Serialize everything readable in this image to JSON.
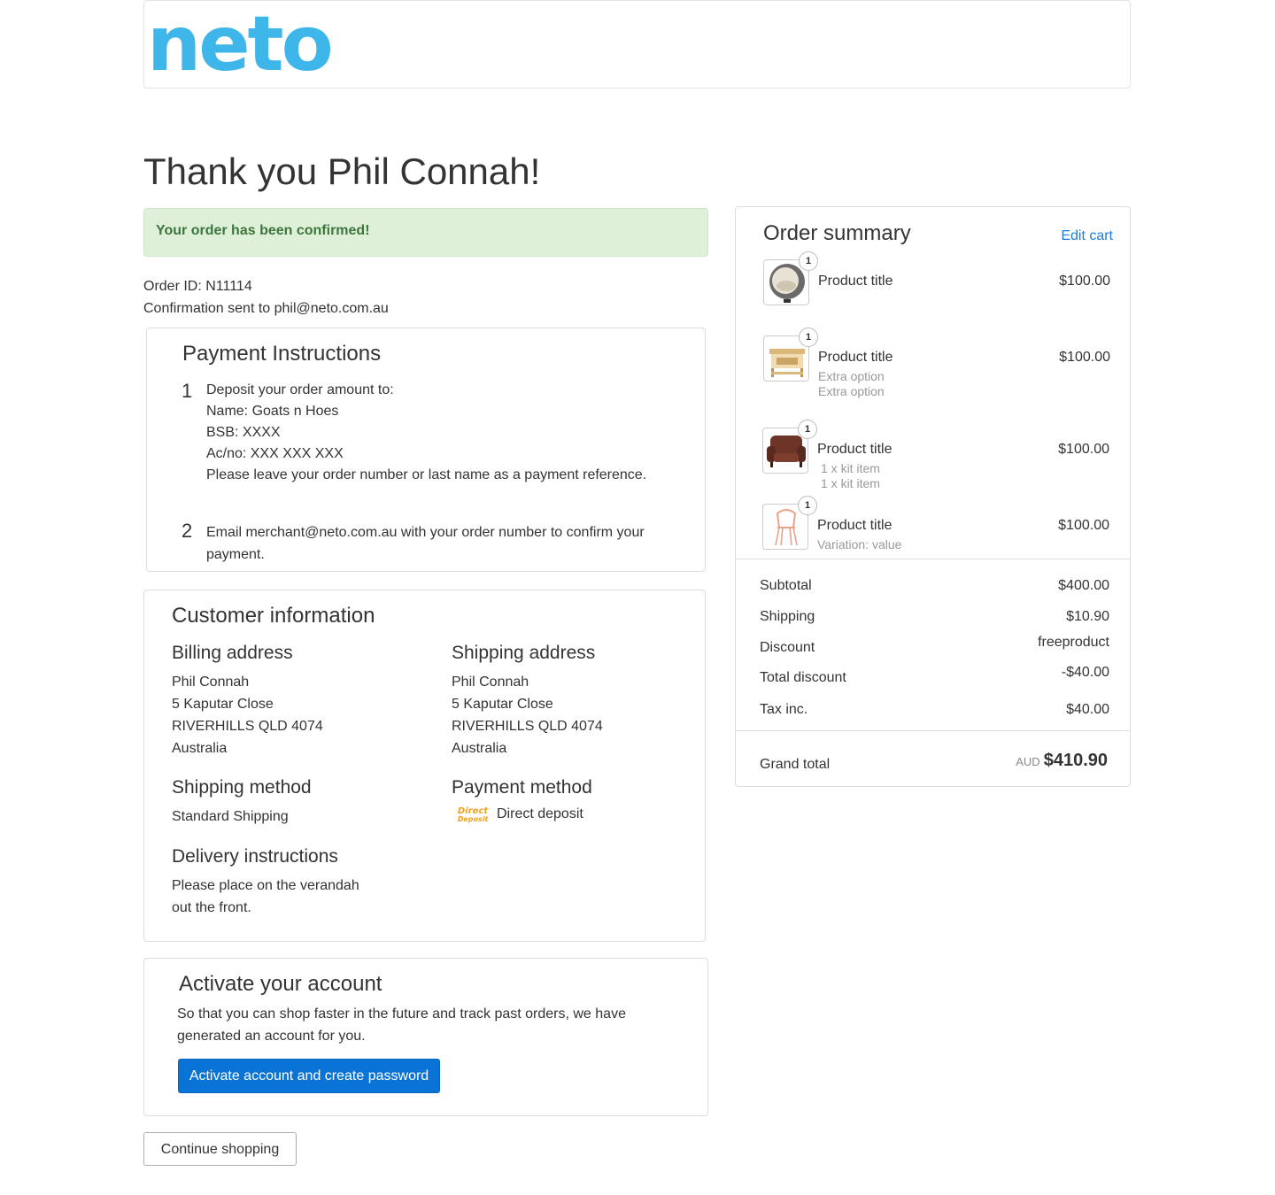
{
  "header": {
    "logo_text": "neto",
    "logo_color": "#3fb6ea"
  },
  "page_title": "Thank you Phil Connah!",
  "alert": {
    "text": "Your order has been confirmed!",
    "color": "#3c763d",
    "background": "#dff0d8"
  },
  "order": {
    "id_line": "Order ID: N11114",
    "confirmation_line": "Confirmation sent to phil@neto.com.au"
  },
  "payment_instructions": {
    "title": "Payment Instructions",
    "steps": [
      {
        "number": "1",
        "lines": [
          "Deposit your order amount to:",
          "Name: Goats n Hoes",
          "BSB: XXXX",
          "Ac/no: XXX XXX XXX",
          "Please leave your order number or last name as a payment reference."
        ]
      },
      {
        "number": "2",
        "lines": [
          "Email merchant@neto.com.au with your order number to confirm your",
          "payment."
        ]
      }
    ]
  },
  "customer": {
    "title": "Customer information",
    "billing": {
      "heading": "Billing address",
      "lines": [
        "Phil Connah",
        "5 Kaputar Close",
        "RIVERHILLS QLD 4074",
        "Australia"
      ]
    },
    "shipping_address": {
      "heading": "Shipping address",
      "lines": [
        "Phil Connah",
        "5 Kaputar Close",
        "RIVERHILLS QLD 4074",
        "Australia"
      ]
    },
    "shipping_method": {
      "heading": "Shipping method",
      "value": "Standard Shipping"
    },
    "payment_method": {
      "heading": "Payment method",
      "value": "Direct deposit",
      "logo_line1": "Direct",
      "logo_line2": "Deposit",
      "logo_color": "#f3a21b"
    },
    "delivery": {
      "heading": "Delivery instructions",
      "lines": [
        "Please place on the verandah",
        "out the front."
      ]
    }
  },
  "activate": {
    "title": "Activate your account",
    "lines": [
      "So that you can shop faster in the future and track past orders, we have",
      "generated an account for you."
    ],
    "button_label": "Activate account and create password",
    "button_color": "#0a74d6"
  },
  "continue_label": "Continue shopping",
  "summary": {
    "title": "Order summary",
    "edit_label": "Edit cart",
    "items": [
      {
        "qty": "1",
        "title": "Product title",
        "price": "$100.00",
        "details": [],
        "thumb": "ball-chair-icon"
      },
      {
        "qty": "1",
        "title": "Product title",
        "price": "$100.00",
        "details": [
          "Extra option",
          "Extra option"
        ],
        "thumb": "side-table-icon"
      },
      {
        "qty": "1",
        "title": "Product title",
        "price": "$100.00",
        "details": [
          "1 x kit item",
          "1 x kit item"
        ],
        "thumb": "leather-sofa-icon"
      },
      {
        "qty": "1",
        "title": "Product title",
        "price": "$100.00",
        "details": [
          "Variation: value"
        ],
        "thumb": "wire-chair-icon"
      }
    ],
    "totals": [
      {
        "label": "Subtotal",
        "value": "$400.00"
      },
      {
        "label": "Shipping",
        "value": "$10.90"
      },
      {
        "label": "Discount",
        "value": "freeproduct"
      },
      {
        "label": "Total discount",
        "value": "-$40.00"
      },
      {
        "label": "Tax inc.",
        "value": "$40.00"
      }
    ],
    "grand_total": {
      "label": "Grand total",
      "currency": "AUD",
      "value": "$410.90"
    }
  }
}
